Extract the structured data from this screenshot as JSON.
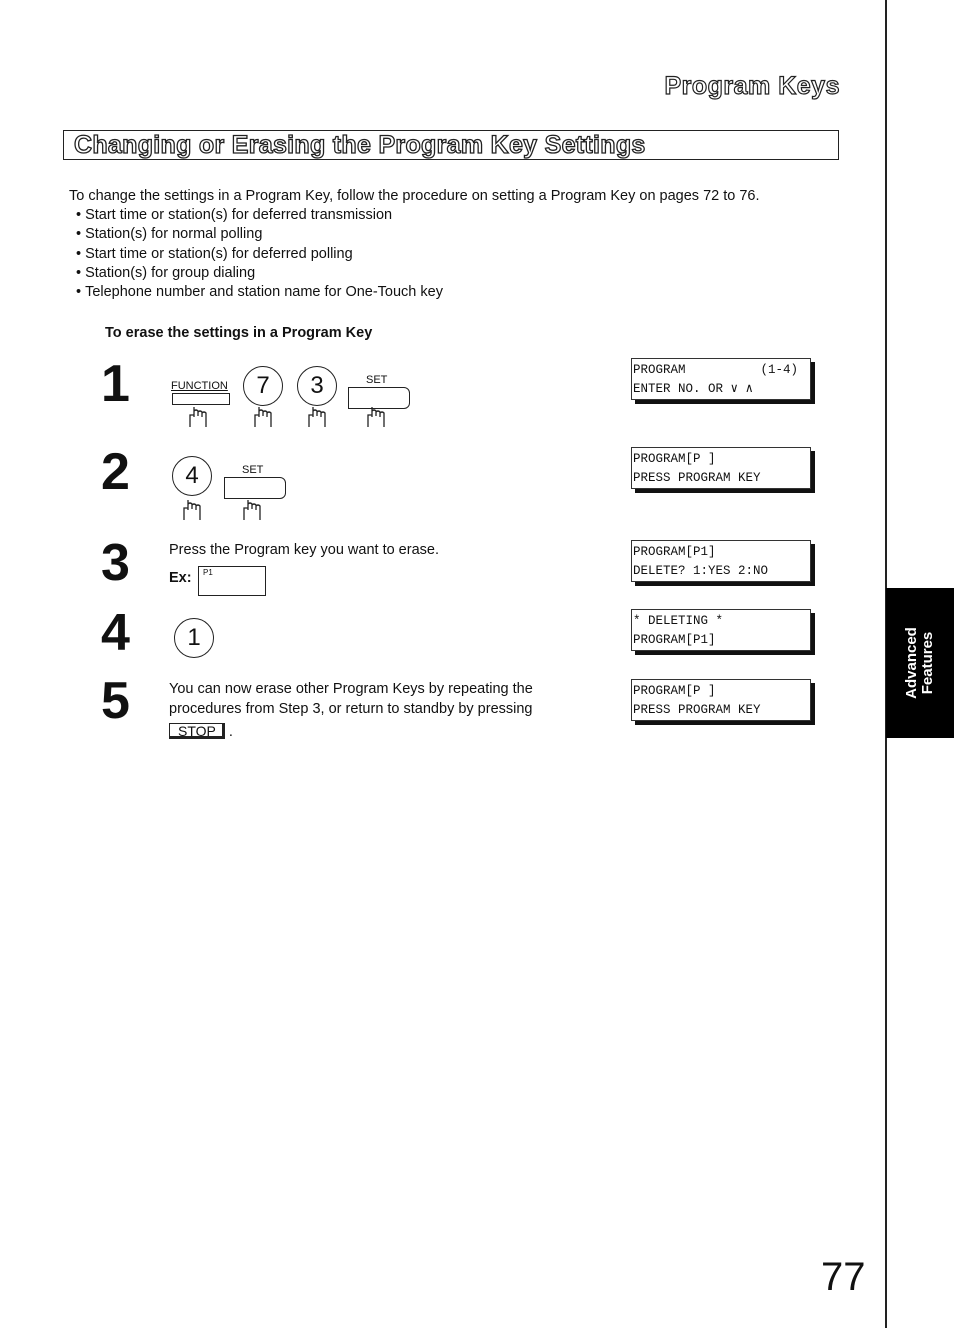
{
  "header": {
    "section_title": "Program Keys"
  },
  "heading": "Changing or Erasing the Program Key Settings",
  "intro": {
    "text": "To change the settings in a Program Key, follow the procedure on setting a Program Key on pages 72 to 76.",
    "bullets": [
      "Start time or station(s) for deferred transmission",
      "Station(s) for normal polling",
      "Start time or station(s) for deferred polling",
      "Station(s) for group dialing",
      "Telephone number and station name for One-Touch key"
    ]
  },
  "subheading": "To erase the settings in a Program Key",
  "steps": [
    {
      "number": "1",
      "keys": {
        "function_label": "FUNCTION",
        "key1": "7",
        "key2": "3",
        "set_label": "SET"
      },
      "lcd": [
        "PROGRAM          (1-4)",
        "ENTER NO. OR ∨ ∧"
      ]
    },
    {
      "number": "2",
      "keys": {
        "key1": "4",
        "set_label": "SET"
      },
      "lcd": [
        "PROGRAM[P ]",
        "PRESS PROGRAM KEY"
      ]
    },
    {
      "number": "3",
      "text": "Press the Program key you want to erase.",
      "ex_label": "Ex:",
      "ex_key_label": "P1",
      "lcd": [
        "PROGRAM[P1]",
        "DELETE? 1:YES 2:NO"
      ]
    },
    {
      "number": "4",
      "keys": {
        "key1": "1"
      },
      "lcd": [
        "* DELETING *",
        "PROGRAM[P1]"
      ]
    },
    {
      "number": "5",
      "text_line1": "You can now erase other Program Keys by repeating the",
      "text_line2": "procedures from Step 3, or return to standby by pressing",
      "stop_label": "STOP",
      "trailing": ".",
      "lcd": [
        "PROGRAM[P ]",
        "PRESS PROGRAM KEY"
      ]
    }
  ],
  "side_tab": {
    "line1": "Advanced",
    "line2": "Features"
  },
  "page_number": "77"
}
